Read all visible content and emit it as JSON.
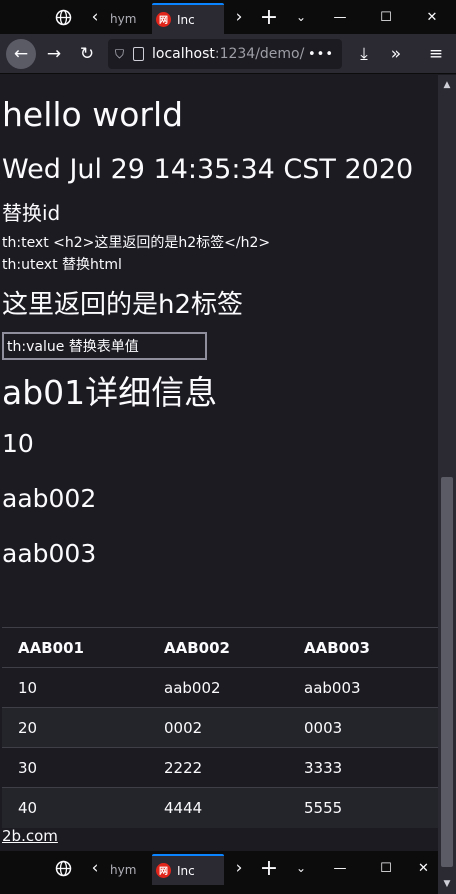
{
  "browser": {
    "tabs": [
      {
        "label": "hym"
      },
      {
        "label": "Inc"
      }
    ],
    "window_controls": {
      "minimize": "—",
      "maximize": "☐",
      "close": "✕"
    },
    "url_host": "localhost",
    "url_rest": ":1234/demo/",
    "url_more": "•••"
  },
  "page": {
    "heading": "hello world",
    "date": "Wed Jul 29 14:35:34 CST 2020",
    "replace_id": "替换id",
    "th_text_line": "th:text <h2>这里返回的是h2标签</h2>",
    "th_utext_line": "th:utext 替换html",
    "h2_text": "这里返回的是h2标签",
    "input_value": "th:value 替换表单值",
    "detail_title": "ab01详细信息",
    "value_1": "10",
    "value_2": "aab002",
    "value_3": "aab003",
    "table": {
      "headers": [
        "AAB001",
        "AAB002",
        "AAB003"
      ],
      "rows": [
        [
          "10",
          "aab002",
          "aab003"
        ],
        [
          "20",
          "0002",
          "0003"
        ],
        [
          "30",
          "2222",
          "3333"
        ],
        [
          "40",
          "4444",
          "5555"
        ]
      ]
    },
    "footer_link": "2b.com"
  },
  "colors": {
    "accent": "#0a84ff",
    "favicon": "#e1251b",
    "background": "#1c1b22"
  }
}
